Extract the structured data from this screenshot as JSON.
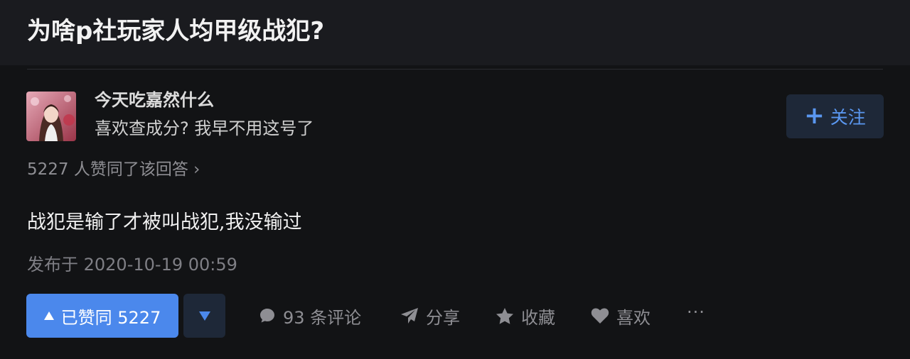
{
  "question": {
    "title": "为啥p社玩家人均甲级战犯?"
  },
  "author": {
    "name": "今天吃嘉然什么",
    "bio": "喜欢查成分? 我早不用这号了",
    "follow_label": "关注"
  },
  "answer": {
    "upvote_summary": "5227 人赞同了该回答 ›",
    "content": "战犯是输了才被叫战犯,我没输过",
    "publish_time": "发布于 2020-10-19 00:59"
  },
  "actions": {
    "vote_up_label": "已赞同 5227",
    "comments_label": "93 条评论",
    "share_label": "分享",
    "collect_label": "收藏",
    "like_label": "喜欢",
    "more_label": "···"
  },
  "colors": {
    "accent": "#4b88ec",
    "background": "#121315",
    "header_background": "#1a1b1f",
    "secondary_button": "#1e2838"
  }
}
